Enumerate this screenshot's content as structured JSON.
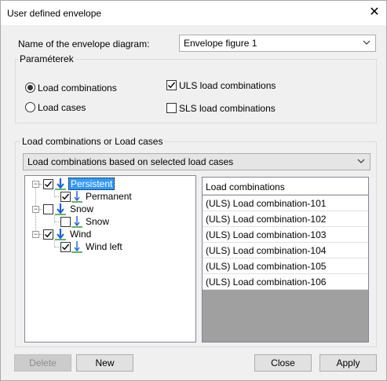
{
  "window": {
    "title": "User defined envelope",
    "close_symbol": "✕"
  },
  "envelope": {
    "label": "Name of the envelope diagram:",
    "value": "Envelope figure 1"
  },
  "params": {
    "title": "Paraméterek",
    "radio_load_combinations": "Load combinations",
    "radio_load_cases": "Load cases",
    "check_uls": "ULS load combinations",
    "check_sls": "SLS load combinations"
  },
  "lc_group": {
    "title": "Load combinations or Load cases",
    "dropdown_value": "Load combinations based on selected load cases"
  },
  "tree": {
    "persistent": "Persistent",
    "permanent": "Permanent",
    "snow_group": "Snow",
    "snow": "Snow",
    "wind_group": "Wind",
    "wind_left": "Wind left"
  },
  "list": {
    "header": "Load combinations",
    "rows": [
      "(ULS) Load combination-101",
      "(ULS) Load combination-102",
      "(ULS) Load combination-103",
      "(ULS) Load combination-104",
      "(ULS) Load combination-105",
      "(ULS) Load combination-106"
    ]
  },
  "buttons": {
    "delete": "Delete",
    "new": "New",
    "close": "Close",
    "apply": "Apply"
  },
  "icons": {
    "load_arrow_color": "#1f5fd6",
    "ground_line_color": "#2e9e3a"
  }
}
